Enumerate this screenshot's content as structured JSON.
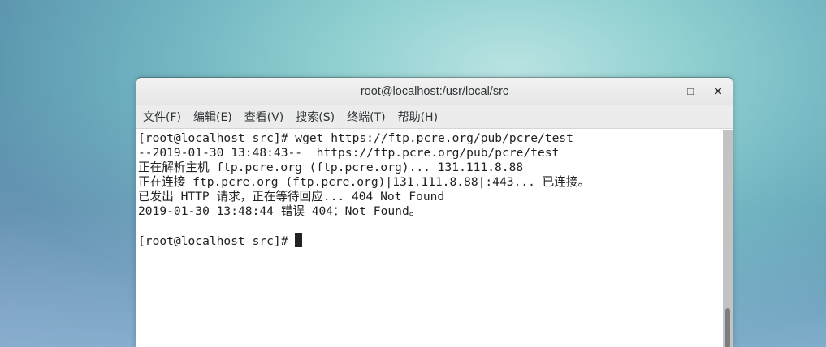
{
  "window": {
    "title": "root@localhost:/usr/local/src",
    "minimize": "_",
    "maximize": "□",
    "close": "×"
  },
  "menu": [
    "文件(F)",
    "编辑(E)",
    "查看(V)",
    "搜索(S)",
    "终端(T)",
    "帮助(H)"
  ],
  "terminal": {
    "lines": [
      "[root@localhost src]# wget https://ftp.pcre.org/pub/pcre/test",
      "--2019-01-30 13:48:43--  https://ftp.pcre.org/pub/pcre/test",
      "正在解析主机 ftp.pcre.org (ftp.pcre.org)... 131.111.8.88",
      "正在连接 ftp.pcre.org (ftp.pcre.org)|131.111.8.88|:443... 已连接。",
      "已发出 HTTP 请求，正在等待回应... 404 Not Found",
      "2019-01-30 13:48:44 错误 404：Not Found。",
      ""
    ],
    "prompt": "[root@localhost src]# "
  }
}
